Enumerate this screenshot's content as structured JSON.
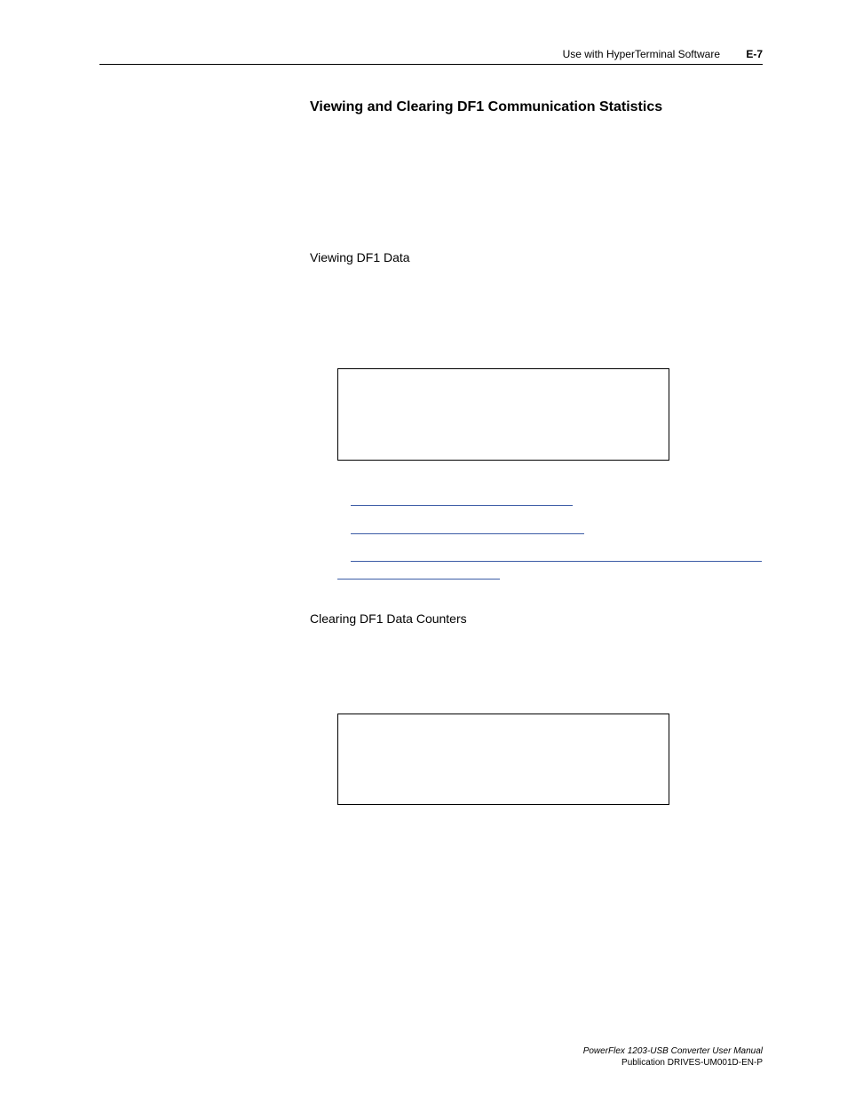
{
  "header": {
    "section": "Use with HyperTerminal Software",
    "pageNum": "E-7"
  },
  "headings": {
    "main": "Viewing and Clearing DF1 Communication Statistics",
    "view": "Viewing DF1 Data",
    "clear": "Clearing DF1 Data Counters"
  },
  "footer": {
    "title": "PowerFlex 1203-USB Converter User Manual",
    "publication": "Publication DRIVES-UM001D-EN-P"
  }
}
